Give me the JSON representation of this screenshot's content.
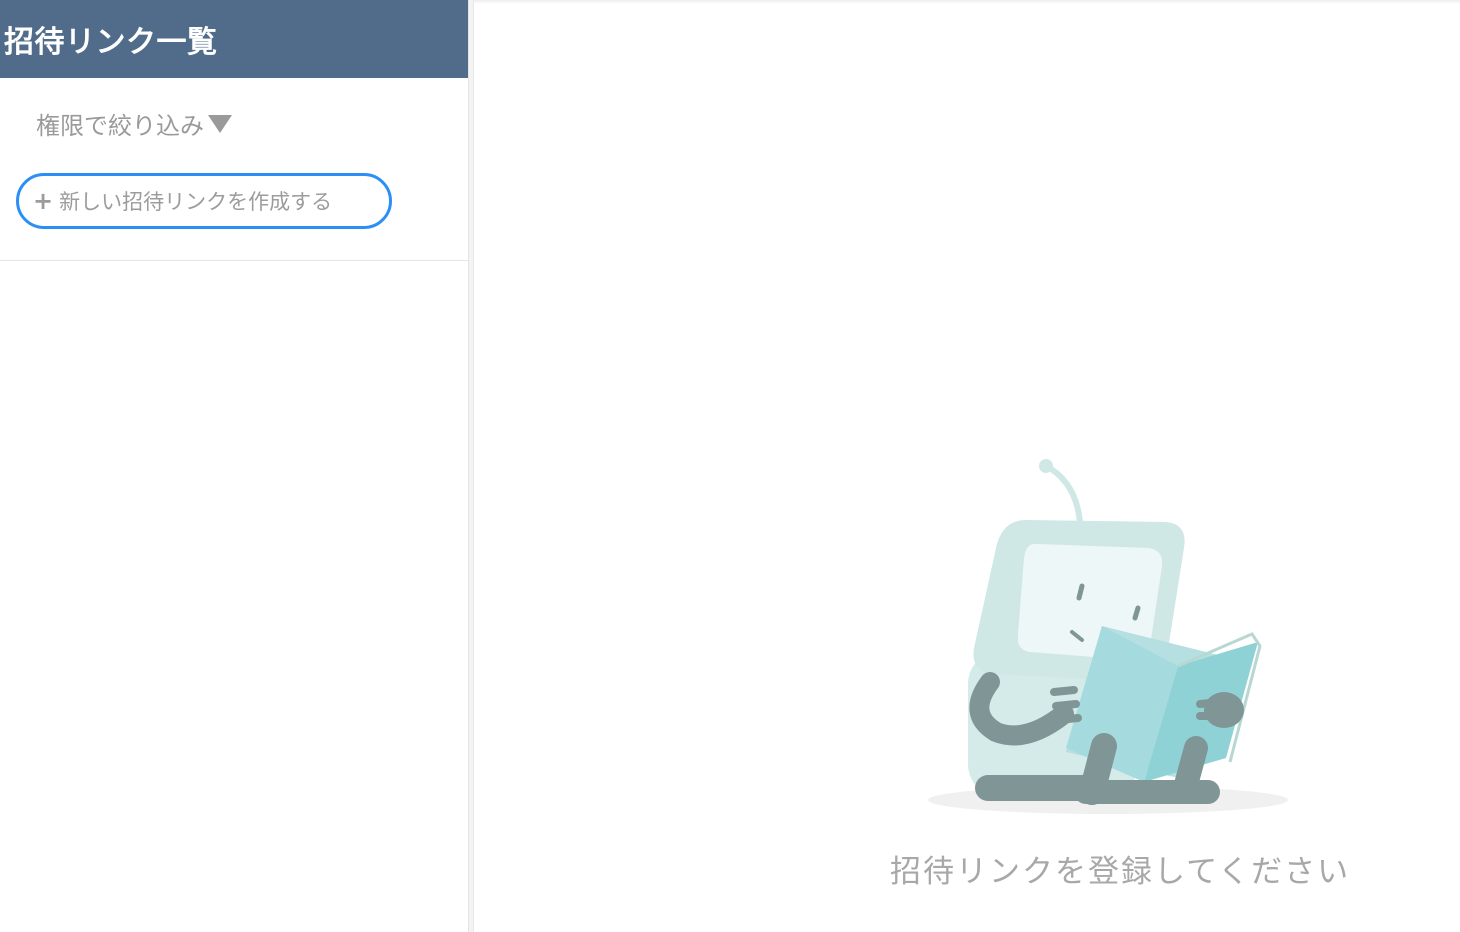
{
  "sidebar": {
    "title": "招待リンク一覧",
    "filter_label": "権限で絞り込み",
    "filter_caret_icon": "caret-down-icon",
    "create_label": "新しい招待リンクを作成する",
    "create_icon": "plus-icon",
    "items": []
  },
  "main": {
    "empty_message": "招待リンクを登録してください",
    "illustration": "robot-reading-book-illustration"
  },
  "colors": {
    "header_bg": "#506c8a",
    "button_border": "#2b8ff5",
    "muted_text": "#9a9a9a",
    "robot_body": "#cfe8e6",
    "robot_arms": "#7f9596",
    "book": "#8fd2d6"
  }
}
